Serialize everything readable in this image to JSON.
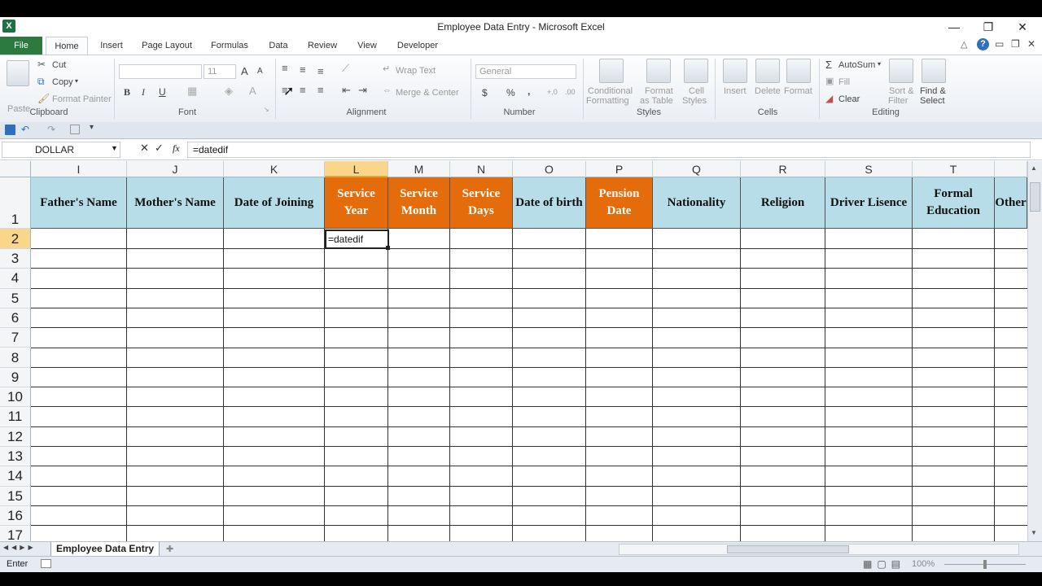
{
  "title": "Employee Data Entry  -  Microsoft Excel",
  "tabs": [
    "File",
    "Home",
    "Insert",
    "Page Layout",
    "Formulas",
    "Data",
    "Review",
    "View",
    "Developer"
  ],
  "ribbon": {
    "clipboard": {
      "paste": "Paste",
      "cut": "Cut",
      "copy": "Copy",
      "format_painter": "Format Painter",
      "label": "Clipboard"
    },
    "font": {
      "size": "11",
      "label": "Font",
      "bold": "B",
      "italic": "I",
      "underline": "U"
    },
    "alignment": {
      "wrap": "Wrap Text",
      "merge": "Merge & Center",
      "label": "Alignment"
    },
    "number": {
      "format": "General",
      "currency": "$",
      "percent": "%",
      "comma": ",",
      "label": "Number"
    },
    "styles": {
      "cond_l1": "Conditional",
      "cond_l2": "Formatting",
      "table_l1": "Format",
      "table_l2": "as Table",
      "cell_l1": "Cell",
      "cell_l2": "Styles",
      "label": "Styles"
    },
    "cells": {
      "insert": "Insert",
      "delete": "Delete",
      "format": "Format",
      "label": "Cells"
    },
    "editing": {
      "autosum": "AutoSum",
      "fill": "Fill",
      "clear": "Clear",
      "sort_l1": "Sort &",
      "sort_l2": "Filter",
      "find_l1": "Find &",
      "find_l2": "Select",
      "label": "Editing"
    }
  },
  "formula_bar": {
    "name_box": "DOLLAR",
    "fx": "fx",
    "value": "=datedif"
  },
  "columns": [
    "I",
    "J",
    "K",
    "L",
    "M",
    "N",
    "O",
    "P",
    "Q",
    "R",
    "S",
    "T",
    ""
  ],
  "headers": [
    {
      "text": "Father's Name",
      "style": "blue"
    },
    {
      "text": "Mother's Name",
      "style": "blue"
    },
    {
      "text": "Date of Joining",
      "style": "blue"
    },
    {
      "text": "Service\nYear",
      "style": "orange"
    },
    {
      "text": "Service\nMonth",
      "style": "orange"
    },
    {
      "text": "Service\nDays",
      "style": "orange"
    },
    {
      "text": "Date of birth",
      "style": "blue"
    },
    {
      "text": "Pension\nDate",
      "style": "orange"
    },
    {
      "text": "Nationality",
      "style": "blue"
    },
    {
      "text": "Religion",
      "style": "blue"
    },
    {
      "text": "Driver Lisence",
      "style": "blue"
    },
    {
      "text": "Formal\nEducation",
      "style": "blue"
    },
    {
      "text": "Other",
      "style": "blue"
    }
  ],
  "rows": [
    "1",
    "2",
    "3",
    "4",
    "5",
    "6",
    "7",
    "8",
    "9",
    "10",
    "11",
    "12",
    "13",
    "14",
    "15",
    "16",
    "17"
  ],
  "active_cell": {
    "ref": "L2",
    "value": "=datedif"
  },
  "sheet_tab": "Employee Data Entry",
  "status": {
    "mode": "Enter",
    "zoom": "100%"
  },
  "colors": {
    "header_blue": "#b7dde8",
    "header_orange": "#e46c0a",
    "file_tab": "#2c7a3f"
  }
}
